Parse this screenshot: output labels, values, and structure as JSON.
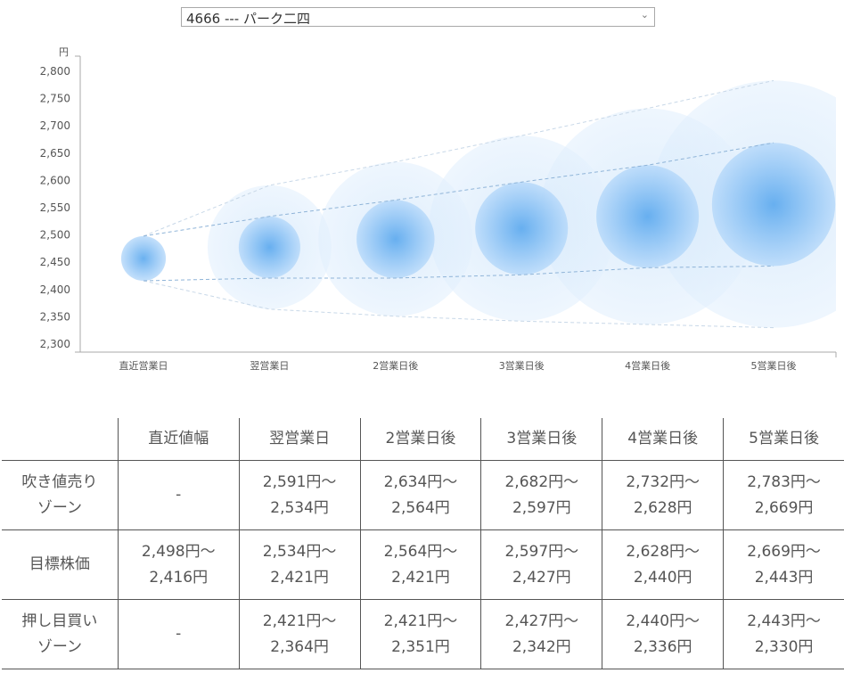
{
  "selector": {
    "value": "4666 --- パーク二四",
    "chevron": "chevron-down-icon"
  },
  "chart_data": {
    "type": "bubble",
    "ylabel": "円",
    "ylim": [
      2272,
      2815
    ],
    "yticks": [
      2300,
      2350,
      2400,
      2450,
      2500,
      2550,
      2600,
      2650,
      2700,
      2750,
      2800
    ],
    "ytick_labels": [
      "2,300",
      "2,350",
      "2,400",
      "2,450",
      "2,500",
      "2,550",
      "2,600",
      "2,650",
      "2,700",
      "2,750",
      "2,800"
    ],
    "categories": [
      "直近営業日",
      "翌営業日",
      "2営業日後",
      "3営業日後",
      "4営業日後",
      "5営業日後"
    ],
    "sell_zone_high": [
      null,
      2591,
      2634,
      2682,
      2732,
      2783
    ],
    "target_high": [
      2498,
      2534,
      2564,
      2597,
      2628,
      2669
    ],
    "target_low": [
      2416,
      2421,
      2421,
      2427,
      2440,
      2443
    ],
    "buy_zone_low": [
      null,
      2364,
      2351,
      2342,
      2336,
      2330
    ],
    "colors": {
      "inner": "#5aa8ee",
      "outer": "#cfe6fb",
      "line": "#8fb4d8"
    }
  },
  "table": {
    "headers": [
      "",
      "直近値幅",
      "翌営業日",
      "2営業日後",
      "3営業日後",
      "4営業日後",
      "5営業日後"
    ],
    "rows": [
      {
        "label": [
          "吹き値売り",
          "ゾーン"
        ],
        "cells": [
          [
            "-"
          ],
          [
            "2,591円～",
            "2,534円"
          ],
          [
            "2,634円～",
            "2,564円"
          ],
          [
            "2,682円～",
            "2,597円"
          ],
          [
            "2,732円～",
            "2,628円"
          ],
          [
            "2,783円～",
            "2,669円"
          ]
        ]
      },
      {
        "label": [
          "目標株価"
        ],
        "cells": [
          [
            "2,498円～",
            "2,416円"
          ],
          [
            "2,534円～",
            "2,421円"
          ],
          [
            "2,564円～",
            "2,421円"
          ],
          [
            "2,597円～",
            "2,427円"
          ],
          [
            "2,628円～",
            "2,440円"
          ],
          [
            "2,669円～",
            "2,443円"
          ]
        ]
      },
      {
        "label": [
          "押し目買い",
          "ゾーン"
        ],
        "cells": [
          [
            "-"
          ],
          [
            "2,421円～",
            "2,364円"
          ],
          [
            "2,421円～",
            "2,351円"
          ],
          [
            "2,427円～",
            "2,342円"
          ],
          [
            "2,440円～",
            "2,336円"
          ],
          [
            "2,443円～",
            "2,330円"
          ]
        ]
      }
    ]
  }
}
